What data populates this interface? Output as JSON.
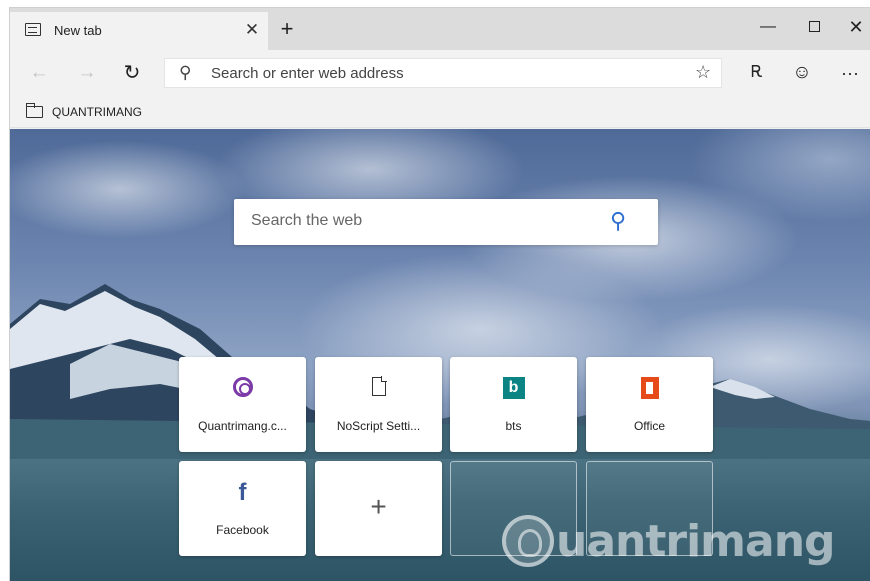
{
  "browser": {
    "tab": {
      "title": "New tab",
      "close_glyph": "✕",
      "icon": "newtab-icon"
    },
    "new_tab_glyph": "+",
    "window_controls": {
      "minimize": "—",
      "maximize": "",
      "close": "✕"
    },
    "nav": {
      "back_glyph": "←",
      "forward_glyph": "→",
      "refresh_glyph": "↻",
      "address_placeholder": "Search or enter web address",
      "search_glyph": "⚲",
      "favorite_glyph": "☆",
      "profile_glyph": "Ꭱ",
      "feedback_glyph": "☺",
      "more_glyph": "···"
    },
    "favorites_bar": {
      "folder_label": "QUANTRIMANG"
    }
  },
  "newtab": {
    "search": {
      "placeholder": "Search the web",
      "icon_glyph": "⚲"
    },
    "top_sites": [
      {
        "label": "Quantrimang.c...",
        "icon": "quantrimang-icon"
      },
      {
        "label": "NoScript Setti...",
        "icon": "page-icon"
      },
      {
        "label": "bts",
        "icon": "bing-icon",
        "glyph": "b"
      },
      {
        "label": "Office",
        "icon": "office-icon"
      },
      {
        "label": "Facebook",
        "icon": "facebook-icon",
        "glyph": "f"
      },
      {
        "label": "",
        "icon": "plus-icon",
        "glyph": "+"
      }
    ],
    "watermark": "uantrimang"
  },
  "colors": {
    "accent_blue": "#2f6fd0",
    "quantrimang_purple": "#7b3aa8",
    "bing_teal": "#0c8484",
    "office_orange": "#e64a19",
    "facebook_blue": "#3b5998"
  }
}
